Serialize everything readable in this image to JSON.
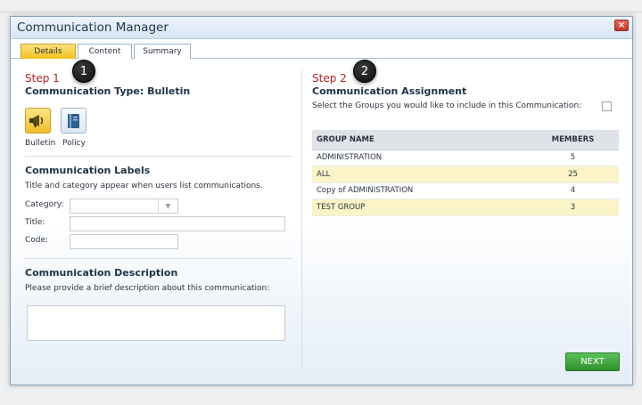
{
  "window": {
    "title": "Communication Manager",
    "close_glyph": "×"
  },
  "tabs": [
    {
      "label": "Details",
      "active": true
    },
    {
      "label": "Content",
      "active": false
    },
    {
      "label": "Summary",
      "active": false
    }
  ],
  "markers": [
    "1",
    "2"
  ],
  "step1": {
    "title": "Step 1",
    "heading": "Communication Type: Bulletin",
    "types": [
      {
        "label": "Bulletin",
        "icon": "megaphone-icon",
        "selected": true
      },
      {
        "label": "Policy",
        "icon": "book-icon",
        "selected": false
      }
    ],
    "labels_heading": "Communication Labels",
    "labels_hint": "Title and category appear when users list communications.",
    "category_label": "Category:",
    "category_value": "",
    "title_label": "Title:",
    "title_value": "",
    "code_label": "Code:",
    "code_value": "",
    "description_heading": "Communication Description",
    "description_hint": "Please provide a brief description about this communication:",
    "description_value": ""
  },
  "step2": {
    "title": "Step 2",
    "heading": "Communication Assignment",
    "select_hint": "Select the Groups you would like to include in this Communication:",
    "select_all_checked": false,
    "columns": [
      "GROUP NAME",
      "MEMBERS"
    ],
    "groups": [
      {
        "name": "ADMINISTRATION",
        "members": "5"
      },
      {
        "name": "ALL",
        "members": "25"
      },
      {
        "name": "Copy of ADMINISTRATION",
        "members": "4"
      },
      {
        "name": "TEST GROUP",
        "members": "3"
      }
    ]
  },
  "next_label": "NEXT",
  "colors": {
    "accent_tab": "#f2c21f",
    "step_red": "#b3261e",
    "next_green": "#3a9a37",
    "row_highlight": "#fbf4c8"
  }
}
